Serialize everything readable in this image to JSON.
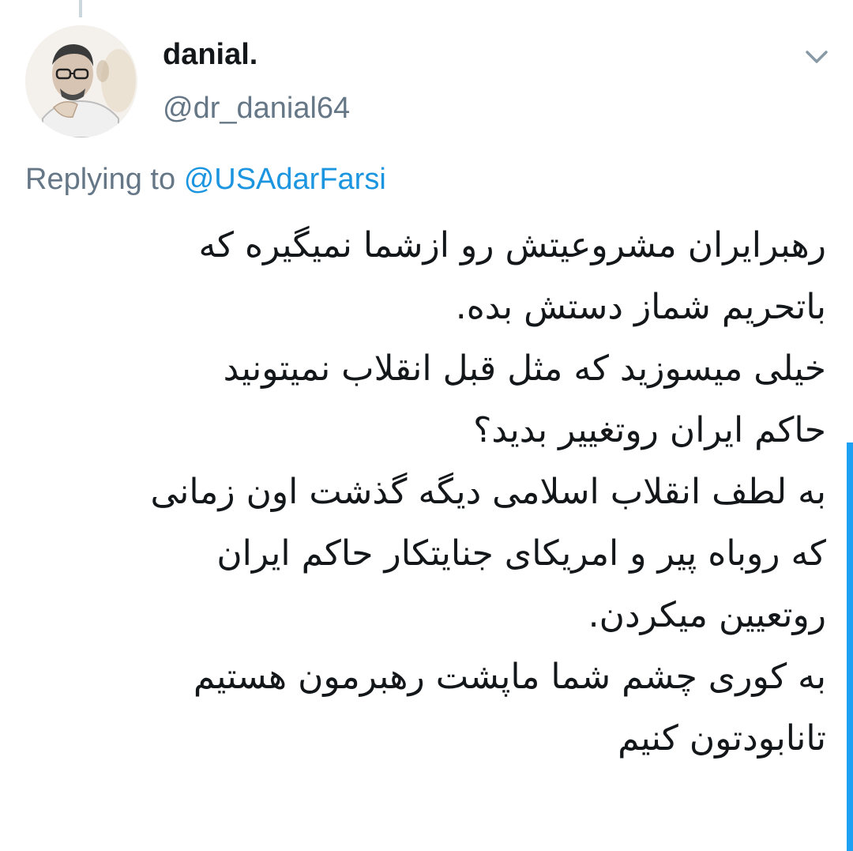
{
  "author": {
    "display_name": "danial.",
    "handle": "@dr_danial64"
  },
  "reply": {
    "prefix": "Replying to",
    "mention": "@USAdarFarsi"
  },
  "tweet": {
    "lines": [
      "رهبرایران مشروعیتش رو ازشما نمیگیره که",
      "باتحریم شماز دستش بده.",
      "خیلی میسوزید که مثل قبل انقلاب نمیتونید",
      "حاکم ایران روتغییر بدید؟",
      "به لطف انقلاب اسلامی دیگه گذشت اون زمانی",
      "که روباه پیر و امریکای جنایتکار حاکم ایران",
      "روتعیین میکردن.",
      "به کوری چشم شما ماپشت رهبرمون هستیم",
      "تانابودتون کنیم"
    ]
  },
  "icons": {
    "menu": "chevron-down-icon"
  },
  "colors": {
    "text_primary": "#14171a",
    "text_secondary": "#657786",
    "link": "#1b95e0",
    "scrollbar": "#1da1f2",
    "thread_line": "#ccd6dd"
  }
}
